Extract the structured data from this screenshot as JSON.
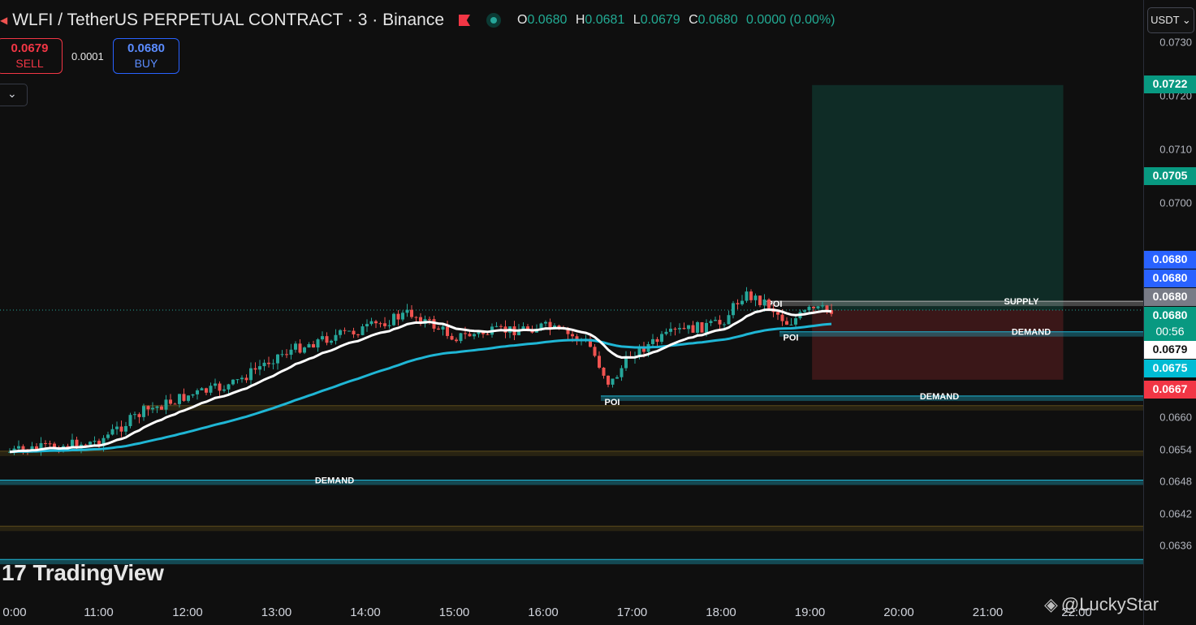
{
  "header": {
    "symbol_title": "WLFI / TetherUS PERPETUAL CONTRACT · 3 · Binance",
    "ohlc": {
      "open_label": "O",
      "open": "0.0680",
      "high_label": "H",
      "high": "0.0681",
      "low_label": "L",
      "low": "0.0679",
      "close_label": "C",
      "close": "0.0680",
      "change": "0.0000 (0.00%)"
    },
    "currency": "USDT ⌄"
  },
  "trade": {
    "sell_price": "0.0679",
    "sell_label": "SELL",
    "spread": "0.0001",
    "buy_price": "0.0680",
    "buy_label": "BUY",
    "collapse_glyph": "⌄"
  },
  "price_axis": {
    "ticks": [
      "0.0730",
      "0.0720",
      "0.0710",
      "0.0700",
      "0.0660",
      "0.0654",
      "0.0648",
      "0.0642",
      "0.0636"
    ],
    "badges": [
      {
        "text": "0.0722",
        "color": "#089981"
      },
      {
        "text": "0.0705",
        "color": "#089981"
      },
      {
        "text": "0.0680",
        "color": "#2962ff"
      },
      {
        "text": "0.0680",
        "color": "#2962ff"
      },
      {
        "text": "0.0680",
        "color": "#787b86"
      },
      {
        "text": "0.0680",
        "sub": "00:56",
        "color": "#089981"
      },
      {
        "text": "0.0679",
        "color": "#ffffff"
      },
      {
        "text": "0.0675",
        "color": "#00bcd4"
      },
      {
        "text": "0.0667",
        "color": "#f23645"
      }
    ]
  },
  "time_axis": [
    "0:00",
    "11:00",
    "12:00",
    "13:00",
    "14:00",
    "15:00",
    "16:00",
    "17:00",
    "18:00",
    "19:00",
    "20:00",
    "21:00",
    "22:00"
  ],
  "zones": {
    "supply": "SUPPLY",
    "demand": "DEMAND",
    "poi": "POI"
  },
  "branding": {
    "logo_text": "TradingView",
    "logo_mark": "17",
    "watermark": "@LuckyStar"
  },
  "colors": {
    "up": "#26a69a",
    "down": "#ef5350",
    "ema_fast": "#ffffff",
    "ema_slow": "#1fb6d5",
    "profit": "#0f2c26",
    "loss": "#3a1718"
  },
  "chart_data": {
    "type": "candlestick",
    "instrument": "WLFI / TetherUS PERPETUAL CONTRACT",
    "interval": "3",
    "exchange": "Binance",
    "x_range": [
      "10:00",
      "22:00"
    ],
    "ylim": [
      0.0633,
      0.0733
    ],
    "time_ticks": [
      "0:00",
      "11:00",
      "12:00",
      "13:00",
      "14:00",
      "15:00",
      "16:00",
      "17:00",
      "18:00",
      "19:00",
      "20:00",
      "21:00",
      "22:00"
    ],
    "price_ticks": [
      0.073,
      0.072,
      0.071,
      0.07,
      0.066,
      0.0654,
      0.0648,
      0.0642,
      0.0636
    ],
    "close_path": [
      {
        "t": "10:00",
        "p": 0.06535
      },
      {
        "t": "10:30",
        "p": 0.06545
      },
      {
        "t": "11:00",
        "p": 0.06555
      },
      {
        "t": "11:30",
        "p": 0.0661
      },
      {
        "t": "12:00",
        "p": 0.0664
      },
      {
        "t": "12:30",
        "p": 0.0666
      },
      {
        "t": "13:00",
        "p": 0.06715
      },
      {
        "t": "13:30",
        "p": 0.06745
      },
      {
        "t": "14:00",
        "p": 0.06765
      },
      {
        "t": "14:30",
        "p": 0.06795
      },
      {
        "t": "15:00",
        "p": 0.0675
      },
      {
        "t": "15:30",
        "p": 0.0676
      },
      {
        "t": "16:00",
        "p": 0.0677
      },
      {
        "t": "16:30",
        "p": 0.0674
      },
      {
        "t": "16:45",
        "p": 0.0666
      },
      {
        "t": "17:00",
        "p": 0.0672
      },
      {
        "t": "17:30",
        "p": 0.0676
      },
      {
        "t": "18:00",
        "p": 0.06775
      },
      {
        "t": "18:15",
        "p": 0.0683
      },
      {
        "t": "18:30",
        "p": 0.06815
      },
      {
        "t": "18:45",
        "p": 0.06775
      },
      {
        "t": "19:00",
        "p": 0.068
      },
      {
        "t": "19:15",
        "p": 0.068
      }
    ],
    "position": {
      "entry": 0.068,
      "take_profit": 0.0722,
      "stop_loss": 0.0667,
      "target_2": 0.0705
    },
    "annotations": [
      "SUPPLY",
      "DEMAND",
      "POI"
    ]
  }
}
